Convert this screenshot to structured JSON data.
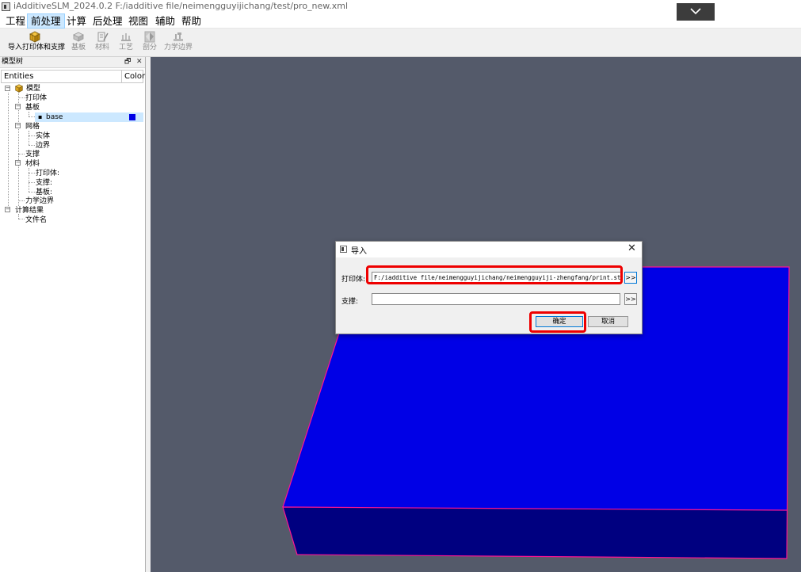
{
  "window": {
    "title": "iAdditiveSLM_2024.0.2 F:/iadditive file/neimengguyijichang/test/pro_new.xml"
  },
  "menubar": {
    "items": [
      "工程",
      "前处理",
      "计算",
      "后处理",
      "视图",
      "辅助",
      "帮助"
    ],
    "active_index": 1
  },
  "toolbar": {
    "items": [
      {
        "label": "导入打印体和支撑",
        "icon": "import-parts-icon"
      },
      {
        "label": "基板",
        "icon": "baseplate-icon"
      },
      {
        "label": "材料",
        "icon": "material-icon"
      },
      {
        "label": "工艺",
        "icon": "process-icon"
      },
      {
        "label": "剖分",
        "icon": "mesh-icon"
      },
      {
        "label": "力学边界",
        "icon": "mechanical-boundary-icon"
      }
    ]
  },
  "model_tree": {
    "title": "模型树",
    "float_glyph": "🗗",
    "close_glyph": "✕",
    "columns": [
      "Entities",
      "Color"
    ],
    "nodes": {
      "model": "模型",
      "print_body": "打印体",
      "baseplate": "基板",
      "base": "base",
      "base_color": "#0000e6",
      "mesh": "网格",
      "solid": "实体",
      "boundary": "边界",
      "support": "支撑",
      "material": "材料",
      "material_print": "打印体:",
      "material_support": "支撑:",
      "material_baseplate": "基板:",
      "mech_boundary": "力学边界",
      "results": "计算结果",
      "filename": "文件名"
    }
  },
  "viewport": {
    "background": "#545a6a",
    "plate_top_color": "#0000e6",
    "plate_side_color": "#000080",
    "edge_color": "#ff1493"
  },
  "dialog": {
    "title": "导入",
    "close_glyph": "✕",
    "print_label": "打印体:",
    "print_value": "F:/iadditive file/neimengguyijichang/neimengguyiji-zhengfang/print.stl",
    "support_label": "支撑:",
    "support_value": "",
    "browse_label": ">>",
    "ok_label": "确定",
    "cancel_label": "取消"
  },
  "highlights": {
    "color": "#e00000"
  }
}
